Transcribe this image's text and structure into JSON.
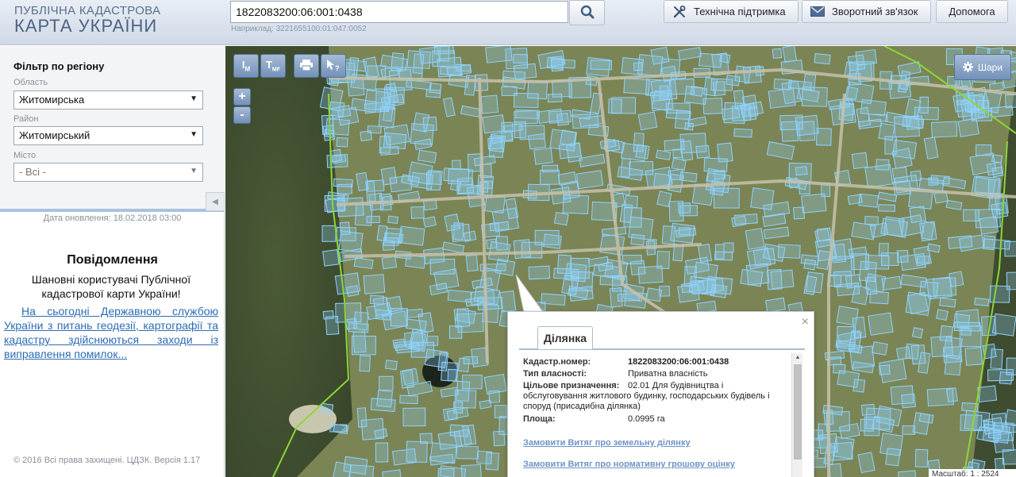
{
  "header": {
    "logo_top": "ПУБЛІЧНА КАДАСТРОВА",
    "logo_bottom": "КАРТА УКРАЇНИ",
    "search_value": "1822083200:06:001:0438",
    "search_hint": "Наприклад: 3221655100:01:047:0052",
    "support_label": "Технічна підтримка",
    "feedback_label": "Зворотний зв'язок",
    "help_label": "Допомога"
  },
  "sidebar": {
    "filter_title": "Фільтр по регіону",
    "region_label": "Область",
    "region_value": "Житомирська",
    "district_label": "Район",
    "district_value": "Житомирський",
    "city_label": "Місто",
    "city_value": "- Всі -",
    "update_date": "Дата оновлення: 18.02.2018 03:00",
    "notice_title": "Повідомлення",
    "notice_text": "Шановні користувачі Публічної кадастрової карти України!",
    "notice_link": "На сьогодні Державною службою України з питань геодезії, картографії та кадастру здійснюються заходи із виправлення помилок...",
    "copyright": "© 2016 Всі права захищені. ЦДЗК. Версія 1.17"
  },
  "map": {
    "tool_measure_line": "M",
    "tool_measure_area": "MF",
    "layers_label": "Шари",
    "zoom_in": "+",
    "zoom_out": "-",
    "scale_text": "Масштаб: 1 : 2524"
  },
  "popup": {
    "tab_label": "Ділянка",
    "close": "×",
    "fields": [
      {
        "key": "Кадастр.номер:",
        "value": "1822083200:06:001:0438"
      },
      {
        "key": "Тип власності:",
        "value": "Приватна власність"
      },
      {
        "key": "Цільове призначення:",
        "value": "02.01 Для будівництва і обслуговування житлового будинку, господарських будівель і споруд (присадибна ділянка)"
      },
      {
        "key": "Площа:",
        "value": "0.0995 га"
      }
    ],
    "link_extract": "Замовити Витяг про земельну ділянку",
    "link_valuation": "Замовити Витяг про нормативну грошову оцінку"
  },
  "colors": {
    "parcel_outline": "#8fd3ff",
    "boundary_line": "#8bd63a",
    "link": "#2d6bb3",
    "tool_button": "#7391b8"
  }
}
